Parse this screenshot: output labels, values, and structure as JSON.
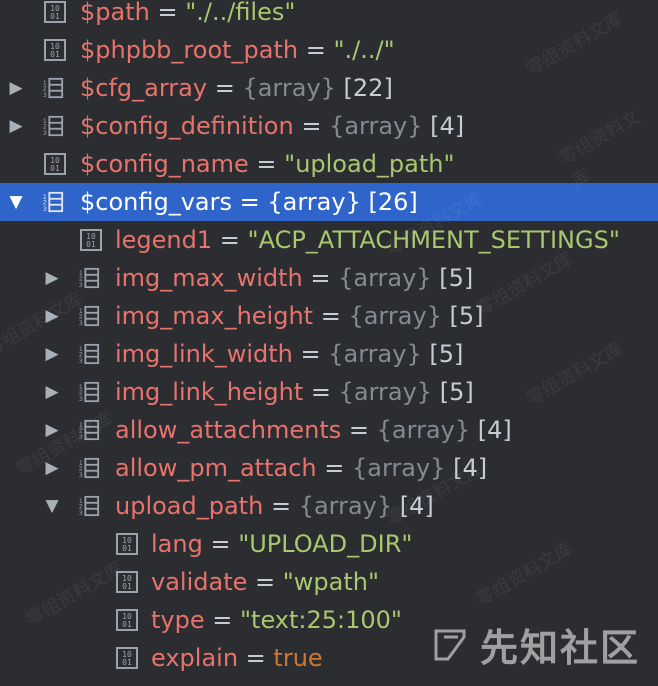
{
  "rows": [
    {
      "name": "$path",
      "op": " = ",
      "value": "\"./../files\"",
      "count": ""
    },
    {
      "name": "$phpbb_root_path",
      "op": " = ",
      "value": "\"./../\"",
      "count": ""
    },
    {
      "name": "$cfg_array",
      "op": " = ",
      "value": "{array}",
      "count": " [22]"
    },
    {
      "name": "$config_definition",
      "op": " = ",
      "value": "{array}",
      "count": " [4]"
    },
    {
      "name": "$config_name",
      "op": " = ",
      "value": "\"upload_path\"",
      "count": ""
    },
    {
      "name": "$config_vars",
      "op": " = ",
      "value": "{array}",
      "count": " [26]"
    },
    {
      "name": "legend1",
      "op": " = ",
      "value": "\"ACP_ATTACHMENT_SETTINGS\"",
      "count": ""
    },
    {
      "name": "img_max_width",
      "op": " = ",
      "value": "{array}",
      "count": " [5]"
    },
    {
      "name": "img_max_height",
      "op": " = ",
      "value": "{array}",
      "count": " [5]"
    },
    {
      "name": "img_link_width",
      "op": " = ",
      "value": "{array}",
      "count": " [5]"
    },
    {
      "name": "img_link_height",
      "op": " = ",
      "value": "{array}",
      "count": " [5]"
    },
    {
      "name": "allow_attachments",
      "op": " = ",
      "value": "{array}",
      "count": " [4]"
    },
    {
      "name": "allow_pm_attach",
      "op": " = ",
      "value": "{array}",
      "count": " [4]"
    },
    {
      "name": "upload_path",
      "op": " = ",
      "value": "{array}",
      "count": " [4]"
    },
    {
      "name": "lang",
      "op": " = ",
      "value": "\"UPLOAD_DIR\"",
      "count": ""
    },
    {
      "name": "validate",
      "op": " = ",
      "value": "\"wpath\"",
      "count": ""
    },
    {
      "name": "type",
      "op": " = ",
      "value": "\"text:25:100\"",
      "count": ""
    },
    {
      "name": "explain",
      "op": " = ",
      "value": "true",
      "count": ""
    }
  ],
  "watermark": {
    "brand_text": "先知社区",
    "tile_text": "零组资料文库"
  },
  "colors": {
    "background": "#2b2d30",
    "selection": "#2f65ca",
    "name": "#e8736d",
    "string": "#a9c76f",
    "boolean": "#cc7832",
    "array": "#848a92"
  }
}
